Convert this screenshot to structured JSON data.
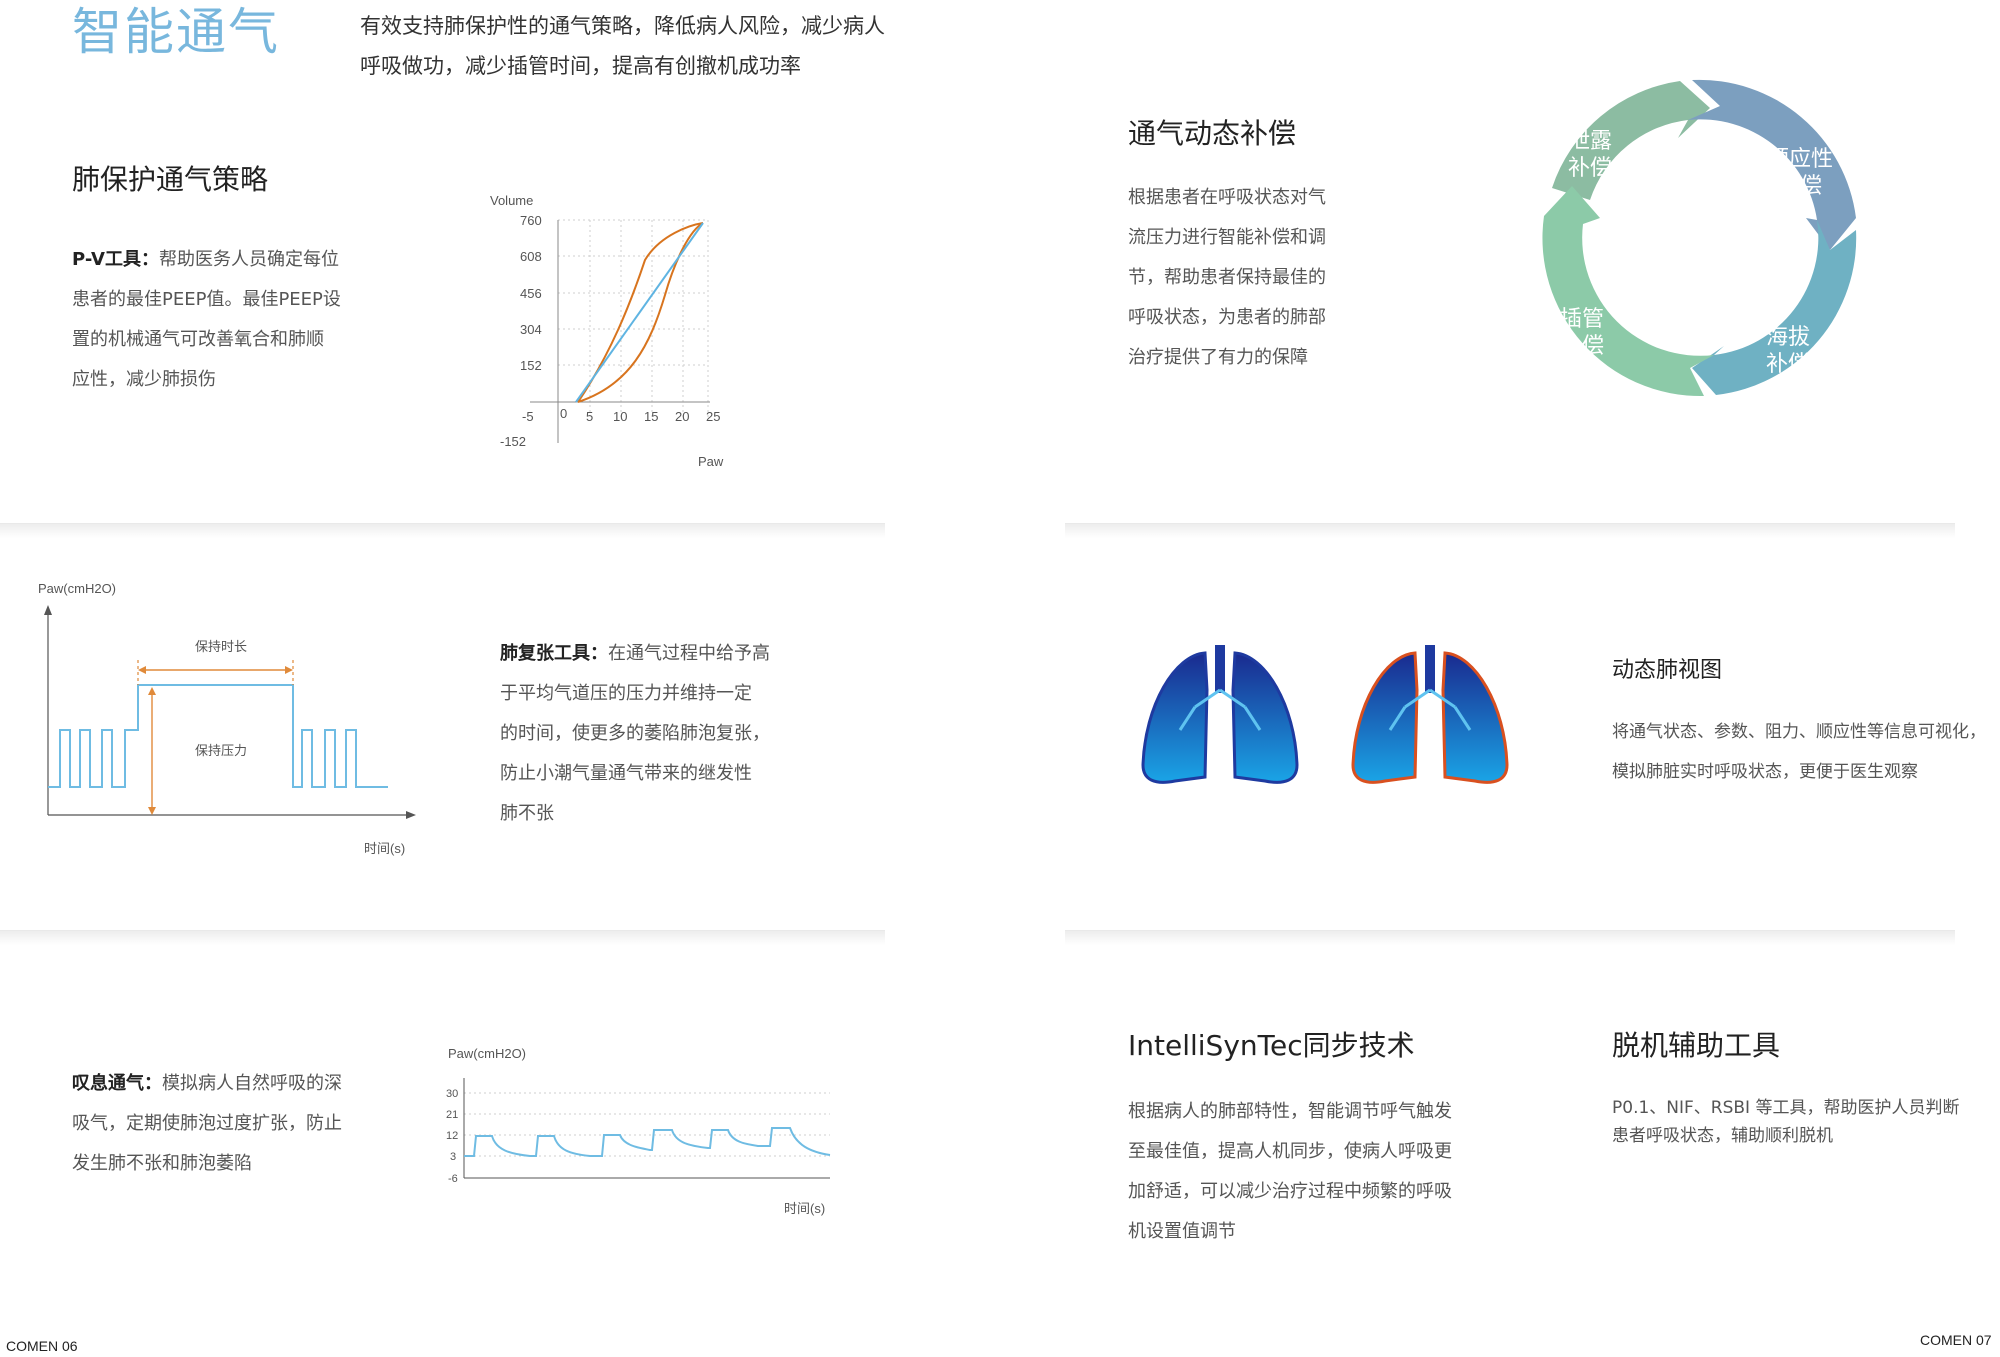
{
  "header": {
    "title": "智能通气",
    "intro_line1": "有效支持肺保护性的通气策略，降低病人风险，减少病人",
    "intro_line2": "呼吸做功，减少插管时间，提高有创撤机成功率"
  },
  "lung_protection": {
    "heading": "肺保护通气策略",
    "pv_label": "P-V工具：",
    "pv_line1_rest": "帮助医务人员确定每位",
    "pv_line2": "患者的最佳PEEP值。最佳PEEP设",
    "pv_line3": "置的机械通气可改善氧合和肺顺",
    "pv_line4": "应性，减少肺损伤"
  },
  "pv_chart": {
    "ylabel": "Volume",
    "xlabel": "Paw",
    "yticks": [
      "760",
      "608",
      "456",
      "304",
      "152",
      "-152"
    ],
    "xticks": [
      "-5",
      "0",
      "5",
      "10",
      "15",
      "20",
      "25"
    ]
  },
  "dynamic_comp": {
    "heading": "通气动态补偿",
    "line1": "根据患者在呼吸状态对气",
    "line2": "流压力进行智能补偿和调",
    "line3": "节，帮助患者保持最佳的",
    "line4": "呼吸状态，为患者的肺部",
    "line5": "治疗提供了有力的保障"
  },
  "cycle": {
    "seg1_l1": "泄露",
    "seg1_l2": "补偿",
    "seg2_l1": "顺应性",
    "seg2_l2": "补偿",
    "seg3_l1": "海拔",
    "seg3_l2": "补偿",
    "seg4_l1": "插管",
    "seg4_l2": "补偿",
    "colors": [
      "#8cbca2",
      "#7c9fbf",
      "#6fb1c3",
      "#8ccaa8"
    ]
  },
  "recruit_chart": {
    "ylabel": "Paw(cmH2O)",
    "xlabel": "时间(s)",
    "hold_time": "保持时长",
    "hold_pressure": "保持压力"
  },
  "recruitment": {
    "label": "肺复张工具：",
    "line1_rest": "在通气过程中给予高",
    "line2": "于平均气道压的压力并维持一定",
    "line3": "的时间，使更多的萎陷肺泡复张，",
    "line4": "防止小潮气量通气带来的继发性",
    "line5": "肺不张"
  },
  "lung_view": {
    "heading": "动态肺视图",
    "line1": "将通气状态、参数、阻力、顺应性等信息可视化，",
    "line2": "模拟肺脏实时呼吸状态，更便于医生观察"
  },
  "sigh": {
    "label": "叹息通气：",
    "line1_rest": "模拟病人自然呼吸的深",
    "line2": "吸气，定期使肺泡过度扩张，防止",
    "line3": "发生肺不张和肺泡萎陷"
  },
  "sigh_chart": {
    "ylabel": "Paw(cmH2O)",
    "xlabel": "时间(s)",
    "yticks": [
      "30",
      "21",
      "12",
      "3",
      "-6"
    ]
  },
  "intellisync": {
    "heading": "IntelliSynTec同步技术",
    "line1": "根据病人的肺部特性，智能调节呼气触发",
    "line2": "至最佳值，提高人机同步，使病人呼吸更",
    "line3": "加舒适，可以减少治疗过程中频繁的呼吸",
    "line4": "机设置值调节"
  },
  "weaning": {
    "heading": "脱机辅助工具",
    "line1": "P0.1、NIF、RSBI 等工具，帮助医护人员判断",
    "line2": "患者呼吸状态，辅助顺利脱机"
  },
  "footer": {
    "left_brand": "COMEN",
    "left_page": "06",
    "right_brand": "COMEN",
    "right_page": "07"
  }
}
